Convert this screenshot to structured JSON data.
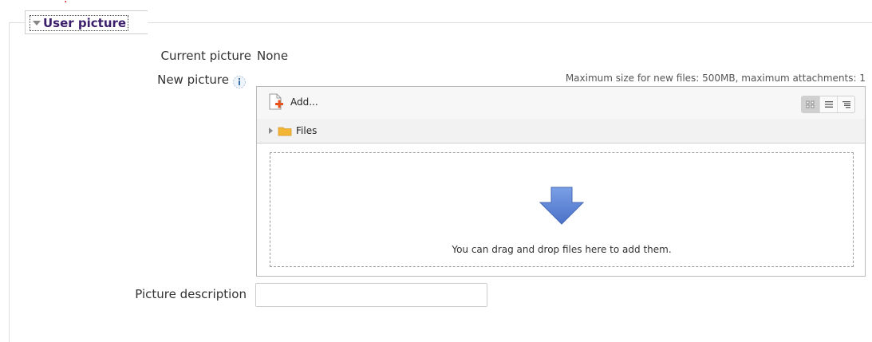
{
  "section": {
    "legend": "User picture"
  },
  "current_picture": {
    "label": "Current picture",
    "value": "None"
  },
  "new_picture": {
    "label": "New picture",
    "help_icon": "info-icon",
    "max_size_text": "Maximum size for new files: 500MB, maximum attachments: 1"
  },
  "filepicker": {
    "add_label": "Add...",
    "folder_label": "Files",
    "view_modes": [
      "icons-view-icon",
      "list-view-icon",
      "tree-view-icon"
    ],
    "dropzone_text": "You can drag and drop files here to add them."
  },
  "picture_description": {
    "label": "Picture description",
    "value": ""
  },
  "colors": {
    "legend_text": "#3a1e6b",
    "arrow_fill": "#5b84d6",
    "folder": "#f2b634",
    "add_plus": "#e8541e"
  }
}
